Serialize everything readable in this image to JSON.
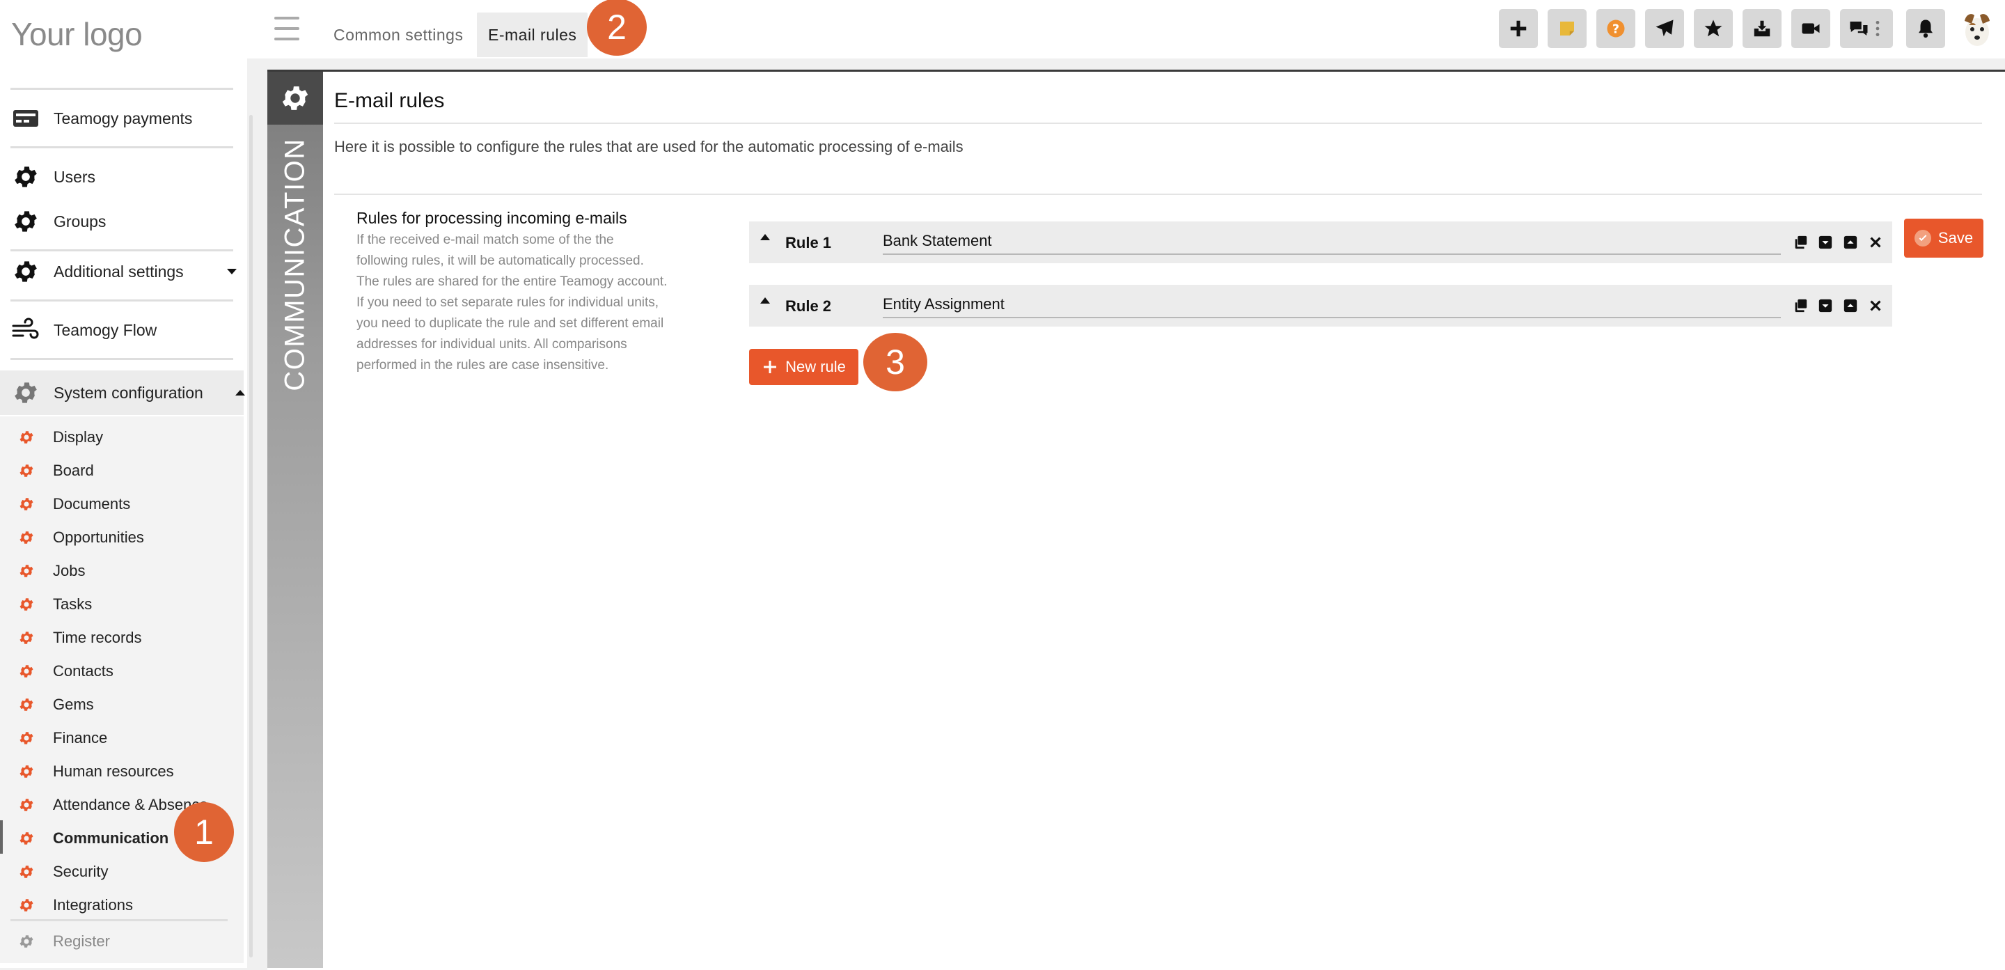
{
  "header": {
    "logo": "Your logo",
    "tabs": [
      {
        "label": "Common settings"
      },
      {
        "label": "E-mail rules"
      }
    ],
    "toolbar_icons": [
      "plus-icon",
      "sticky-note-icon",
      "help-icon",
      "send-icon",
      "star-icon",
      "inbox-icon",
      "video-icon",
      "chat-icon",
      "more-vertical-icon",
      "bell-icon",
      "avatar"
    ]
  },
  "annotations": {
    "badge1": "1",
    "badge2": "2",
    "badge3": "3"
  },
  "sidebar": {
    "items": [
      {
        "label": "Teamogy payments"
      },
      {
        "label": "Users"
      },
      {
        "label": "Groups"
      },
      {
        "label": "Additional settings"
      },
      {
        "label": "Teamogy Flow"
      },
      {
        "label": "System configuration"
      }
    ],
    "sub_items": [
      {
        "label": "Display"
      },
      {
        "label": "Board"
      },
      {
        "label": "Documents"
      },
      {
        "label": "Opportunities"
      },
      {
        "label": "Jobs"
      },
      {
        "label": "Tasks"
      },
      {
        "label": "Time records"
      },
      {
        "label": "Contacts"
      },
      {
        "label": "Gems"
      },
      {
        "label": "Finance"
      },
      {
        "label": "Human resources"
      },
      {
        "label": "Attendance & Absence"
      },
      {
        "label": "Communication",
        "active": true
      },
      {
        "label": "Security"
      },
      {
        "label": "Integrations"
      },
      {
        "label": "Register"
      }
    ]
  },
  "main": {
    "section_label": "COMMUNICATION",
    "title": "E-mail rules",
    "description": "Here it is possible to configure the rules that are used for the automatic processing of e-mails",
    "rules_heading": "Rules for processing incoming e-mails",
    "rules_help_lines": [
      "If the received e-mail match some of the the",
      "following rules, it will be automatically processed.",
      "The rules are shared for the entire Teamogy account.",
      "If you need to set separate rules for individual units,",
      "you need to duplicate the rule and set different email",
      "addresses for individual units. All comparisons",
      "performed in the rules are case insensitive."
    ],
    "rules": [
      {
        "label": "Rule 1",
        "value": "Bank Statement"
      },
      {
        "label": "Rule 2",
        "value": "Entity Assignment"
      }
    ],
    "new_rule_label": "New rule",
    "save_label": "Save"
  },
  "colors": {
    "accent": "#e8572b",
    "badge": "#e06434"
  }
}
